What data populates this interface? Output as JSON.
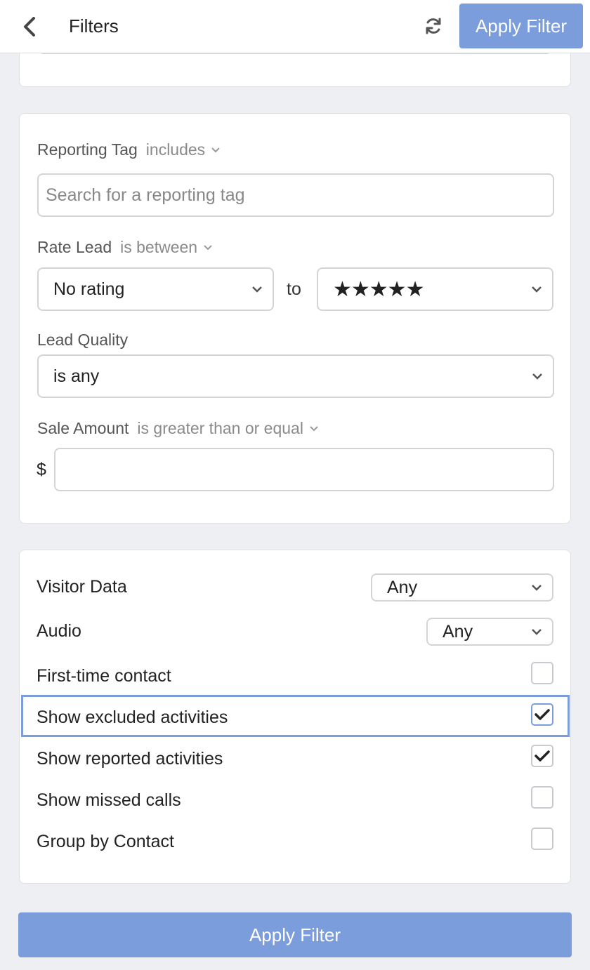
{
  "header": {
    "title": "Filters",
    "apply_label": "Apply Filter"
  },
  "reporting_tag": {
    "label": "Reporting Tag",
    "operator": "includes",
    "placeholder": "Search for a reporting tag"
  },
  "rate_lead": {
    "label": "Rate Lead",
    "operator": "is between",
    "from_value": "No rating",
    "to_label": "to",
    "to_value": "★★★★★"
  },
  "lead_quality": {
    "label": "Lead Quality",
    "value": "is any"
  },
  "sale_amount": {
    "label": "Sale Amount",
    "operator": "is greater than or equal",
    "currency": "$",
    "value": ""
  },
  "options": {
    "visitor_data": {
      "label": "Visitor Data",
      "value": "Any"
    },
    "audio": {
      "label": "Audio",
      "value": "Any"
    },
    "first_time_contact": {
      "label": "First-time contact",
      "checked": false
    },
    "show_excluded": {
      "label": "Show excluded activities",
      "checked": true
    },
    "show_reported": {
      "label": "Show reported activities",
      "checked": true
    },
    "show_missed": {
      "label": "Show missed calls",
      "checked": false
    },
    "group_by_contact": {
      "label": "Group by Contact",
      "checked": false
    }
  },
  "footer": {
    "apply_label": "Apply Filter"
  },
  "colors": {
    "accent": "#7b9ddb",
    "background": "#eeeff3"
  }
}
